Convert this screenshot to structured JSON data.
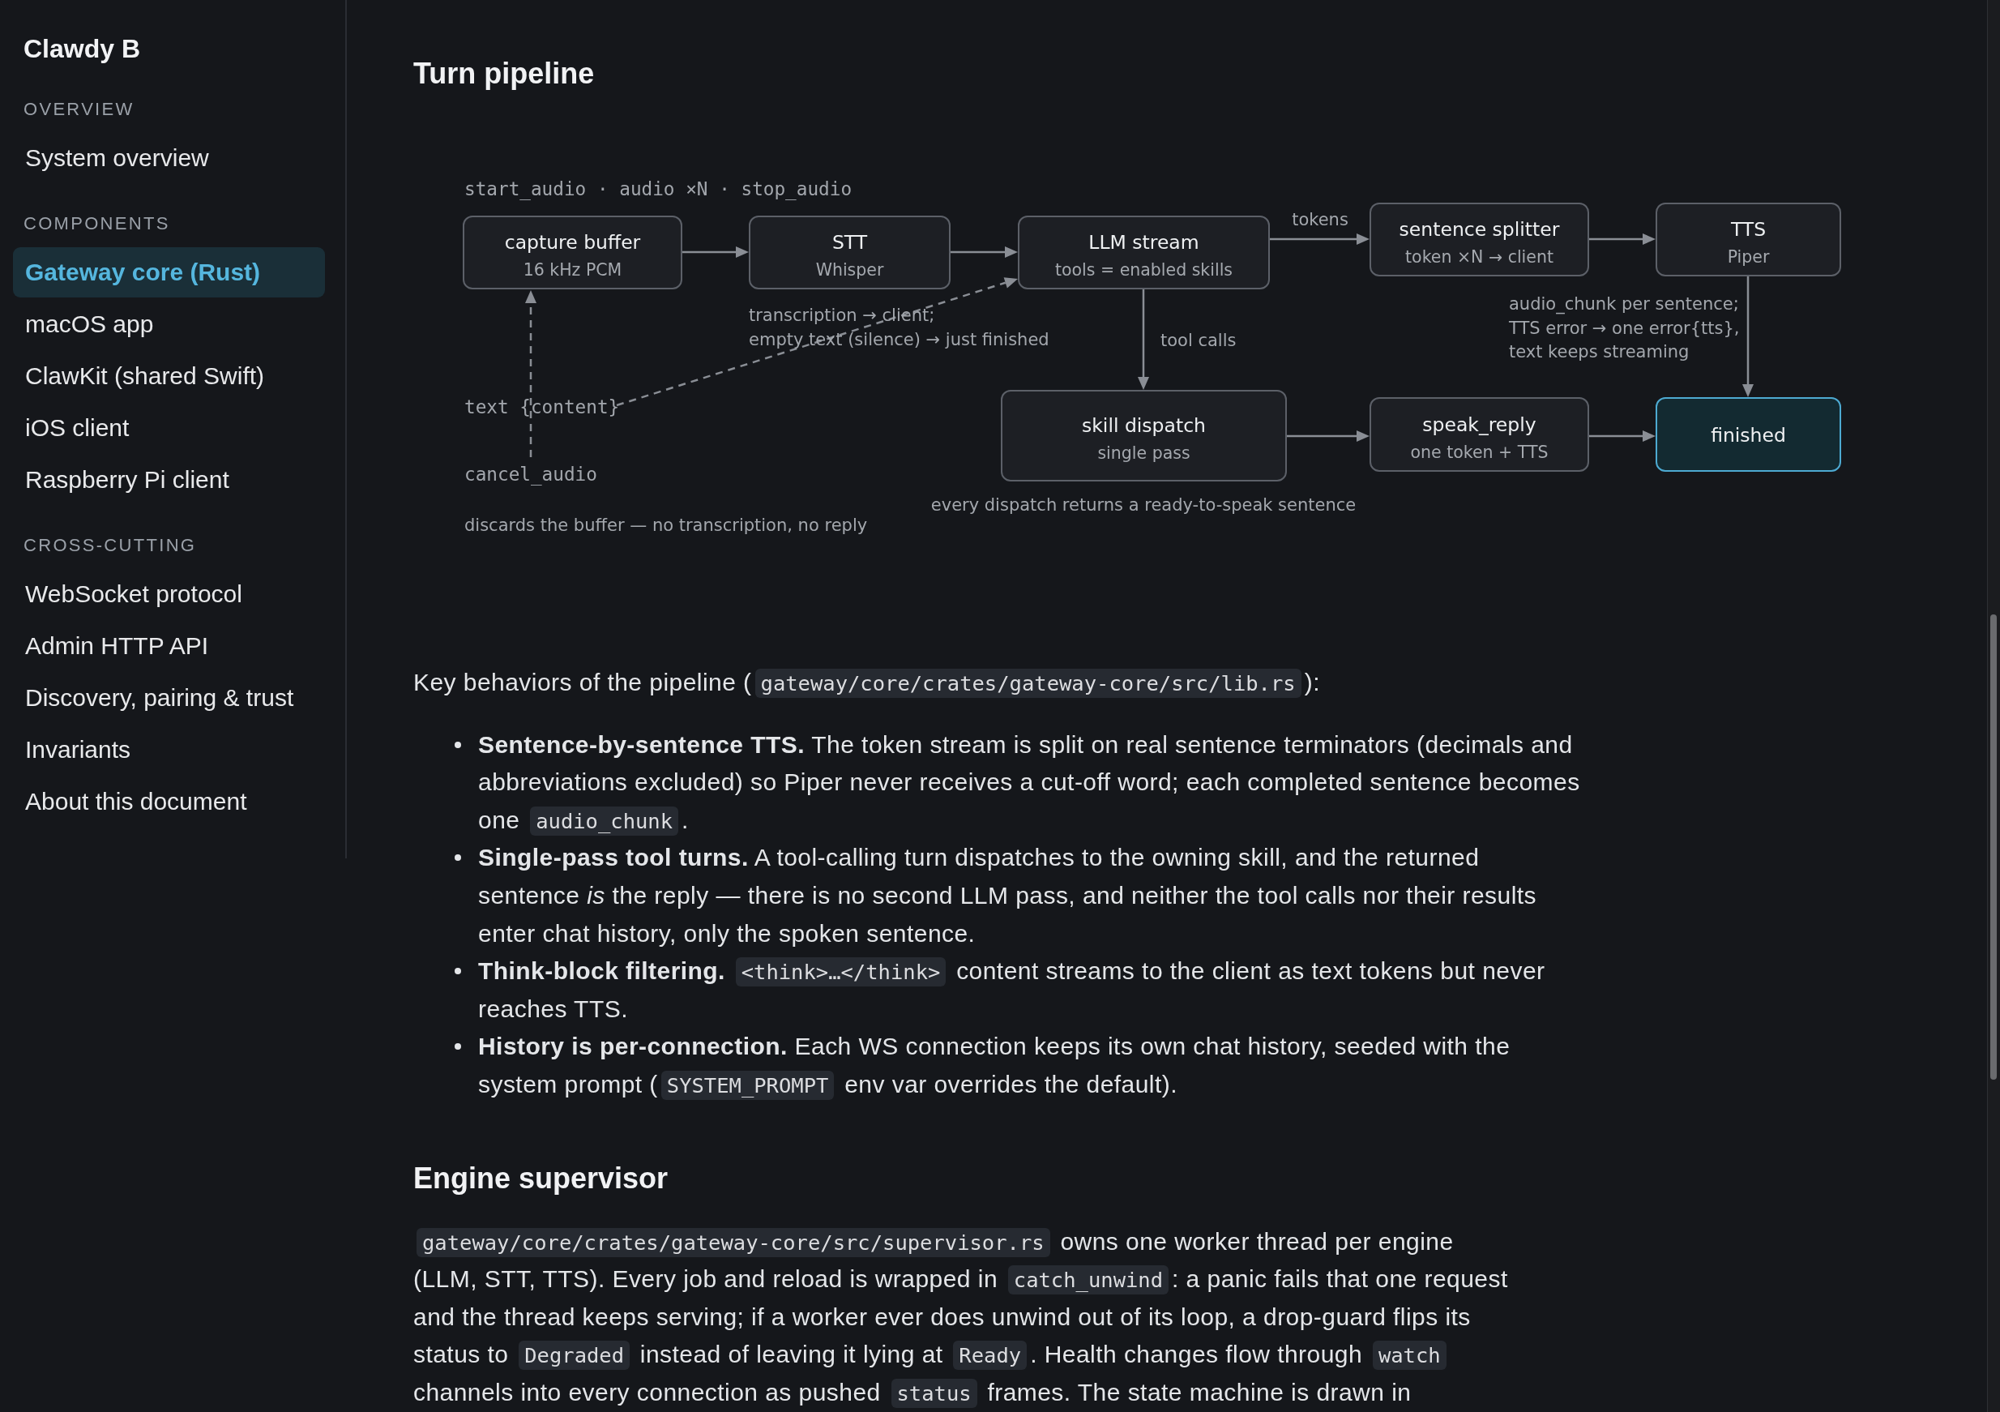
{
  "sidebar": {
    "title": "Clawdy B",
    "sections": [
      {
        "heading": "OVERVIEW",
        "items": [
          {
            "label": "System overview",
            "selected": false
          }
        ]
      },
      {
        "heading": "COMPONENTS",
        "items": [
          {
            "label": "Gateway core (Rust)",
            "selected": true
          },
          {
            "label": "macOS app",
            "selected": false
          },
          {
            "label": "ClawKit (shared Swift)",
            "selected": false
          },
          {
            "label": "iOS client",
            "selected": false
          },
          {
            "label": "Raspberry Pi client",
            "selected": false
          }
        ]
      },
      {
        "heading": "CROSS-CUTTING",
        "items": [
          {
            "label": "WebSocket protocol",
            "selected": false
          },
          {
            "label": "Admin HTTP API",
            "selected": false
          },
          {
            "label": "Discovery, pairing & trust",
            "selected": false
          },
          {
            "label": "Invariants",
            "selected": false
          },
          {
            "label": "About this document",
            "selected": false
          }
        ]
      }
    ]
  },
  "article": {
    "sections": [
      {
        "heading": "Turn pipeline",
        "blocks": [
          {
            "kind": "diagram",
            "nodes": [
              {
                "kind": "step",
                "title": "capture buffer",
                "subtitle": "16 kHz PCM"
              },
              {
                "kind": "step",
                "title": "STT",
                "subtitle": "Whisper"
              },
              {
                "kind": "step",
                "title": "LLM stream",
                "subtitle": "tools = enabled skills"
              },
              {
                "kind": "step",
                "title": "sentence splitter",
                "subtitle": "token ×N → client"
              },
              {
                "kind": "step",
                "title": "TTS",
                "subtitle": "Piper"
              },
              {
                "kind": "step",
                "title": "skill dispatch",
                "subtitle": "single pass"
              },
              {
                "kind": "step",
                "title": "speak_reply",
                "subtitle": "one token + TTS"
              },
              {
                "kind": "terminal",
                "title": "finished"
              }
            ],
            "edges": [
              {
                "kind": "solid"
              },
              {
                "kind": "solid"
              },
              {
                "kind": "solid",
                "label": "tokens"
              },
              {
                "kind": "solid"
              },
              {
                "kind": "solid",
                "label": "tool calls"
              },
              {
                "kind": "solid"
              },
              {
                "kind": "solid"
              },
              {
                "kind": "solid"
              },
              {
                "kind": "dashed"
              },
              {
                "kind": "dashed"
              }
            ],
            "notes": [
              {
                "kind": "event",
                "lines": [
                  "start_audio · audio ×N · stop_audio"
                ]
              },
              {
                "kind": "caption",
                "lines": [
                  "transcription → client;",
                  "empty text (silence) → just finished"
                ]
              },
              {
                "kind": "caption",
                "lines": [
                  "audio_chunk per sentence;",
                  "TTS error → one error{tts},",
                  "text keeps streaming"
                ]
              },
              {
                "kind": "event",
                "lines": [
                  "text {content}"
                ]
              },
              {
                "kind": "event",
                "lines": [
                  "cancel_audio"
                ]
              },
              {
                "kind": "caption",
                "lines": [
                  "discards the buffer — no transcription, no reply"
                ]
              },
              {
                "kind": "caption",
                "lines": [
                  "every dispatch returns a ready-to-speak sentence"
                ]
              }
            ]
          },
          {
            "kind": "paragraph",
            "runs": [
              {
                "kind": "text",
                "text": "Key behaviors of the pipeline ("
              },
              {
                "kind": "code",
                "text": "gateway/core/crates/gateway-core/src/lib.rs"
              },
              {
                "kind": "text",
                "text": "):"
              }
            ]
          },
          {
            "kind": "list",
            "items": [
              {
                "runs": [
                  {
                    "kind": "text",
                    "text": "**Sentence-by-sentence TTS.** The token stream is split on real sentence terminators (decimals and abbreviations excluded) so Piper never receives a cut-off word; each completed sentence becomes one "
                  },
                  {
                    "kind": "code",
                    "text": "audio_chunk"
                  },
                  {
                    "kind": "text",
                    "text": "."
                  }
                ]
              },
              {
                "runs": [
                  {
                    "kind": "text",
                    "text": "**Single-pass tool turns.** A tool-calling turn dispatches to the owning skill, and the returned sentence *is* the reply — there is no second LLM pass, and neither the tool calls nor their results enter chat history, only the spoken sentence."
                  }
                ]
              },
              {
                "runs": [
                  {
                    "kind": "text",
                    "text": "**Think-block filtering.** "
                  },
                  {
                    "kind": "code",
                    "text": "<think>…</think>"
                  },
                  {
                    "kind": "text",
                    "text": " content streams to the client as text tokens but never reaches TTS."
                  }
                ]
              },
              {
                "runs": [
                  {
                    "kind": "text",
                    "text": "**History is per-connection.** Each WS connection keeps its own chat history, seeded with the system prompt ("
                  },
                  {
                    "kind": "code",
                    "text": "SYSTEM_PROMPT"
                  },
                  {
                    "kind": "text",
                    "text": " env var overrides the default)."
                  }
                ]
              }
            ]
          }
        ]
      },
      {
        "heading": "Engine supervisor",
        "blocks": [
          {
            "kind": "paragraph",
            "runs": [
              {
                "kind": "code",
                "text": "gateway/core/crates/gateway-core/src/supervisor.rs"
              },
              {
                "kind": "text",
                "text": " owns one worker thread per engine (LLM, STT, TTS). Every job and reload is wrapped in "
              },
              {
                "kind": "code",
                "text": "catch_unwind"
              },
              {
                "kind": "text",
                "text": ": a panic fails that one request and the thread keeps serving; if a worker ever does unwind out of its loop, a drop-guard flips its status to "
              },
              {
                "kind": "code",
                "text": "Degraded"
              },
              {
                "kind": "text",
                "text": " instead of leaving it lying at "
              },
              {
                "kind": "code",
                "text": "Ready"
              },
              {
                "kind": "text",
                "text": ". Health changes flow through "
              },
              {
                "kind": "code",
                "text": "watch"
              },
              {
                "kind": "text",
                "text": " channels into every connection as pushed "
              },
              {
                "kind": "code",
                "text": "status"
              },
              {
                "kind": "text",
                "text": " frames. The state machine is drawn in"
              }
            ]
          }
        ]
      }
    ]
  }
}
